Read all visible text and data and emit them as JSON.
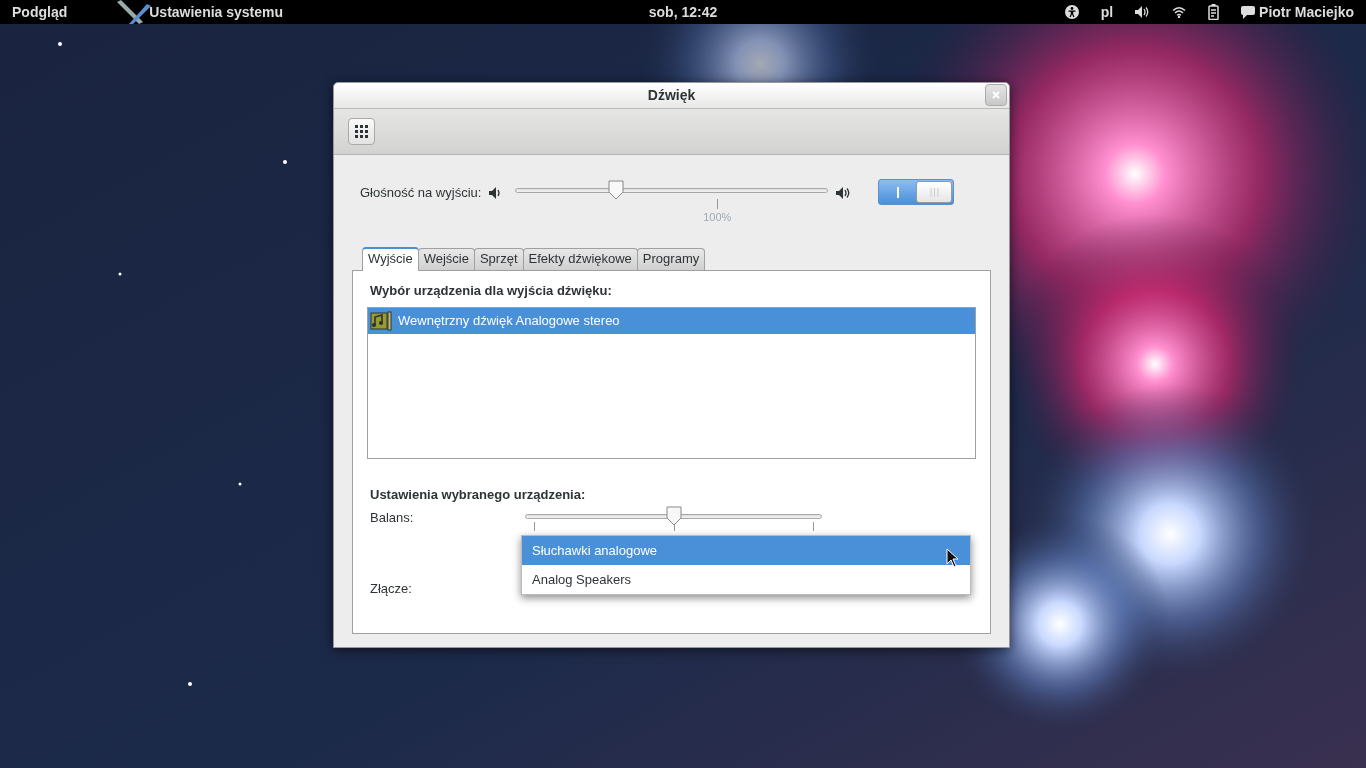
{
  "top_bar": {
    "activities": "Podgląd",
    "app_menu": "Ustawienia systemu",
    "clock": "sob, 12:42",
    "keyboard_layout": "pl",
    "user": "Piotr Maciejko"
  },
  "window": {
    "title": "Dźwięk"
  },
  "output_volume": {
    "label": "Głośność na wyjściu:",
    "level": 0.32,
    "mark_label": "100%",
    "switch_on": true
  },
  "tabs": [
    {
      "label": "Wyjście",
      "selected": true
    },
    {
      "label": "Wejście",
      "selected": false
    },
    {
      "label": "Sprzęt",
      "selected": false
    },
    {
      "label": "Efekty dźwiękowe",
      "selected": false
    },
    {
      "label": "Programy",
      "selected": false
    }
  ],
  "device_section": {
    "heading": "Wybór urządzenia dla wyjścia dźwięku:",
    "devices": [
      {
        "name": "Wewnętrzny dźwięk Analogowe stereo",
        "selected": true
      }
    ]
  },
  "device_settings": {
    "heading": "Ustawienia wybranego urządzenia:",
    "balance": {
      "label": "Balans:",
      "level": 0.5
    },
    "connector": {
      "label": "Złącze:",
      "options": [
        {
          "label": "Słuchawki analogowe",
          "selected": true
        },
        {
          "label": "Analog Speakers",
          "selected": false
        }
      ]
    }
  }
}
